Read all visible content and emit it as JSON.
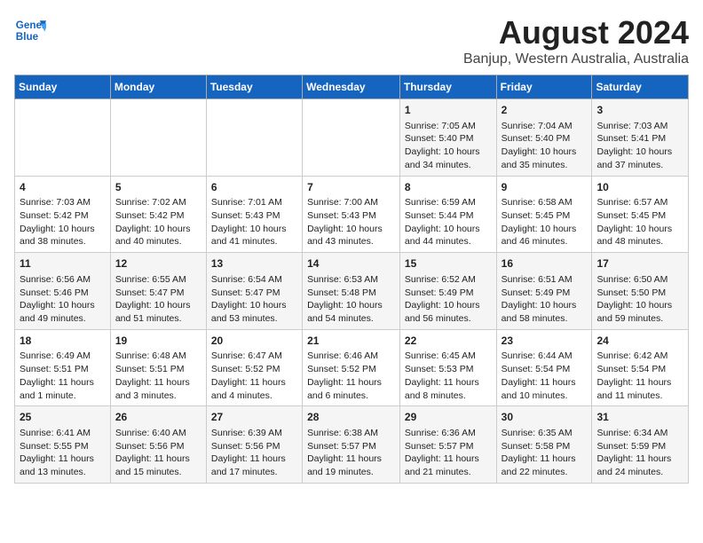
{
  "header": {
    "logo_line1": "General",
    "logo_line2": "Blue",
    "title": "August 2024",
    "subtitle": "Banjup, Western Australia, Australia"
  },
  "days_of_week": [
    "Sunday",
    "Monday",
    "Tuesday",
    "Wednesday",
    "Thursday",
    "Friday",
    "Saturday"
  ],
  "weeks": [
    [
      {
        "day": "",
        "sunrise": "",
        "sunset": "",
        "daylight": "",
        "empty": true
      },
      {
        "day": "",
        "sunrise": "",
        "sunset": "",
        "daylight": "",
        "empty": true
      },
      {
        "day": "",
        "sunrise": "",
        "sunset": "",
        "daylight": "",
        "empty": true
      },
      {
        "day": "",
        "sunrise": "",
        "sunset": "",
        "daylight": "",
        "empty": true
      },
      {
        "day": "1",
        "sunrise": "7:05 AM",
        "sunset": "5:40 PM",
        "daylight": "10 hours and 34 minutes."
      },
      {
        "day": "2",
        "sunrise": "7:04 AM",
        "sunset": "5:40 PM",
        "daylight": "10 hours and 35 minutes."
      },
      {
        "day": "3",
        "sunrise": "7:03 AM",
        "sunset": "5:41 PM",
        "daylight": "10 hours and 37 minutes."
      }
    ],
    [
      {
        "day": "4",
        "sunrise": "7:03 AM",
        "sunset": "5:42 PM",
        "daylight": "10 hours and 38 minutes."
      },
      {
        "day": "5",
        "sunrise": "7:02 AM",
        "sunset": "5:42 PM",
        "daylight": "10 hours and 40 minutes."
      },
      {
        "day": "6",
        "sunrise": "7:01 AM",
        "sunset": "5:43 PM",
        "daylight": "10 hours and 41 minutes."
      },
      {
        "day": "7",
        "sunrise": "7:00 AM",
        "sunset": "5:43 PM",
        "daylight": "10 hours and 43 minutes."
      },
      {
        "day": "8",
        "sunrise": "6:59 AM",
        "sunset": "5:44 PM",
        "daylight": "10 hours and 44 minutes."
      },
      {
        "day": "9",
        "sunrise": "6:58 AM",
        "sunset": "5:45 PM",
        "daylight": "10 hours and 46 minutes."
      },
      {
        "day": "10",
        "sunrise": "6:57 AM",
        "sunset": "5:45 PM",
        "daylight": "10 hours and 48 minutes."
      }
    ],
    [
      {
        "day": "11",
        "sunrise": "6:56 AM",
        "sunset": "5:46 PM",
        "daylight": "10 hours and 49 minutes."
      },
      {
        "day": "12",
        "sunrise": "6:55 AM",
        "sunset": "5:47 PM",
        "daylight": "10 hours and 51 minutes."
      },
      {
        "day": "13",
        "sunrise": "6:54 AM",
        "sunset": "5:47 PM",
        "daylight": "10 hours and 53 minutes."
      },
      {
        "day": "14",
        "sunrise": "6:53 AM",
        "sunset": "5:48 PM",
        "daylight": "10 hours and 54 minutes."
      },
      {
        "day": "15",
        "sunrise": "6:52 AM",
        "sunset": "5:49 PM",
        "daylight": "10 hours and 56 minutes."
      },
      {
        "day": "16",
        "sunrise": "6:51 AM",
        "sunset": "5:49 PM",
        "daylight": "10 hours and 58 minutes."
      },
      {
        "day": "17",
        "sunrise": "6:50 AM",
        "sunset": "5:50 PM",
        "daylight": "10 hours and 59 minutes."
      }
    ],
    [
      {
        "day": "18",
        "sunrise": "6:49 AM",
        "sunset": "5:51 PM",
        "daylight": "11 hours and 1 minute."
      },
      {
        "day": "19",
        "sunrise": "6:48 AM",
        "sunset": "5:51 PM",
        "daylight": "11 hours and 3 minutes."
      },
      {
        "day": "20",
        "sunrise": "6:47 AM",
        "sunset": "5:52 PM",
        "daylight": "11 hours and 4 minutes."
      },
      {
        "day": "21",
        "sunrise": "6:46 AM",
        "sunset": "5:52 PM",
        "daylight": "11 hours and 6 minutes."
      },
      {
        "day": "22",
        "sunrise": "6:45 AM",
        "sunset": "5:53 PM",
        "daylight": "11 hours and 8 minutes."
      },
      {
        "day": "23",
        "sunrise": "6:44 AM",
        "sunset": "5:54 PM",
        "daylight": "11 hours and 10 minutes."
      },
      {
        "day": "24",
        "sunrise": "6:42 AM",
        "sunset": "5:54 PM",
        "daylight": "11 hours and 11 minutes."
      }
    ],
    [
      {
        "day": "25",
        "sunrise": "6:41 AM",
        "sunset": "5:55 PM",
        "daylight": "11 hours and 13 minutes."
      },
      {
        "day": "26",
        "sunrise": "6:40 AM",
        "sunset": "5:56 PM",
        "daylight": "11 hours and 15 minutes."
      },
      {
        "day": "27",
        "sunrise": "6:39 AM",
        "sunset": "5:56 PM",
        "daylight": "11 hours and 17 minutes."
      },
      {
        "day": "28",
        "sunrise": "6:38 AM",
        "sunset": "5:57 PM",
        "daylight": "11 hours and 19 minutes."
      },
      {
        "day": "29",
        "sunrise": "6:36 AM",
        "sunset": "5:57 PM",
        "daylight": "11 hours and 21 minutes."
      },
      {
        "day": "30",
        "sunrise": "6:35 AM",
        "sunset": "5:58 PM",
        "daylight": "11 hours and 22 minutes."
      },
      {
        "day": "31",
        "sunrise": "6:34 AM",
        "sunset": "5:59 PM",
        "daylight": "11 hours and 24 minutes."
      }
    ]
  ],
  "labels": {
    "sunrise_prefix": "Sunrise: ",
    "sunset_prefix": "Sunset: ",
    "daylight_prefix": "Daylight: "
  }
}
